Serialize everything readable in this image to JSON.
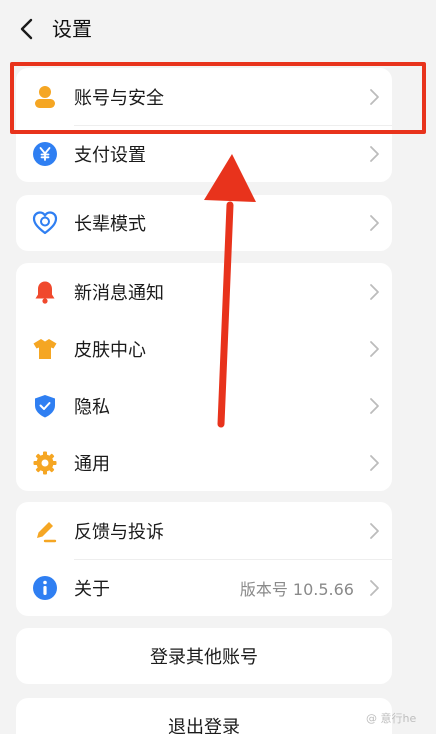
{
  "header": {
    "title": "设置"
  },
  "group1": [
    {
      "label": "账号与安全",
      "icon": "user-icon"
    },
    {
      "label": "支付设置",
      "icon": "yuan-icon"
    }
  ],
  "group2": [
    {
      "label": "长辈模式",
      "icon": "elder-heart-icon"
    }
  ],
  "group3": [
    {
      "label": "新消息通知",
      "icon": "bell-icon"
    },
    {
      "label": "皮肤中心",
      "icon": "shirt-icon"
    },
    {
      "label": "隐私",
      "icon": "shield-icon"
    },
    {
      "label": "通用",
      "icon": "gear-icon"
    }
  ],
  "group4": [
    {
      "label": "反馈与投诉",
      "icon": "pencil-icon"
    },
    {
      "label": "关于",
      "icon": "info-icon",
      "value": "版本号 10.5.66"
    }
  ],
  "buttons": {
    "switch_account": "登录其他账号",
    "logout": "退出登录"
  },
  "watermark": "@ 意行he",
  "colors": {
    "orange": "#f5a623",
    "blue": "#2f7ff2",
    "red": "#f0492d",
    "highlight": "#e8331c"
  }
}
